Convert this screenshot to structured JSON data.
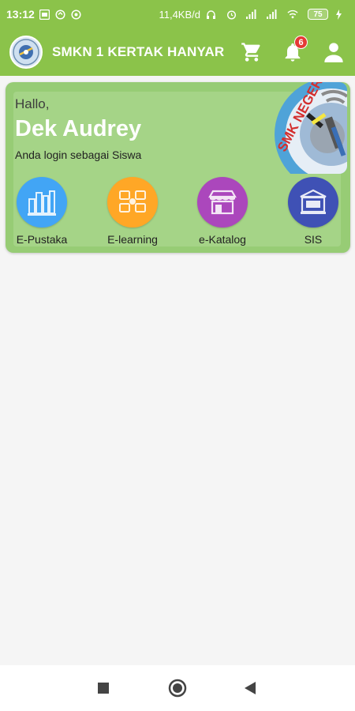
{
  "status_bar": {
    "time": "13:12",
    "network_speed": "11,4KB/d",
    "battery": "75"
  },
  "app_bar": {
    "title": "SMKN 1 KERTAK HANYAR",
    "notification_count": "6",
    "icons": [
      "cart-icon",
      "bell-icon",
      "user-icon"
    ]
  },
  "card": {
    "greeting": "Hallo,",
    "user_name": "Dek Audrey",
    "role_text": "Anda login sebagai Siswa",
    "emblem_text": "SMK NEGERI"
  },
  "menu": [
    {
      "label": "E-Pustaka",
      "icon": "library-icon",
      "color": "#42a5f5"
    },
    {
      "label": "E-learning",
      "icon": "elearning-icon",
      "color": "#ffa726"
    },
    {
      "label": "e-Katalog",
      "icon": "store-icon",
      "color": "#ab47bc"
    },
    {
      "label": "SIS",
      "icon": "sis-icon",
      "color": "#3f51b5"
    }
  ],
  "colors": {
    "primary": "#8bc34a",
    "card": "#97cc75",
    "badge": "#e53935"
  }
}
